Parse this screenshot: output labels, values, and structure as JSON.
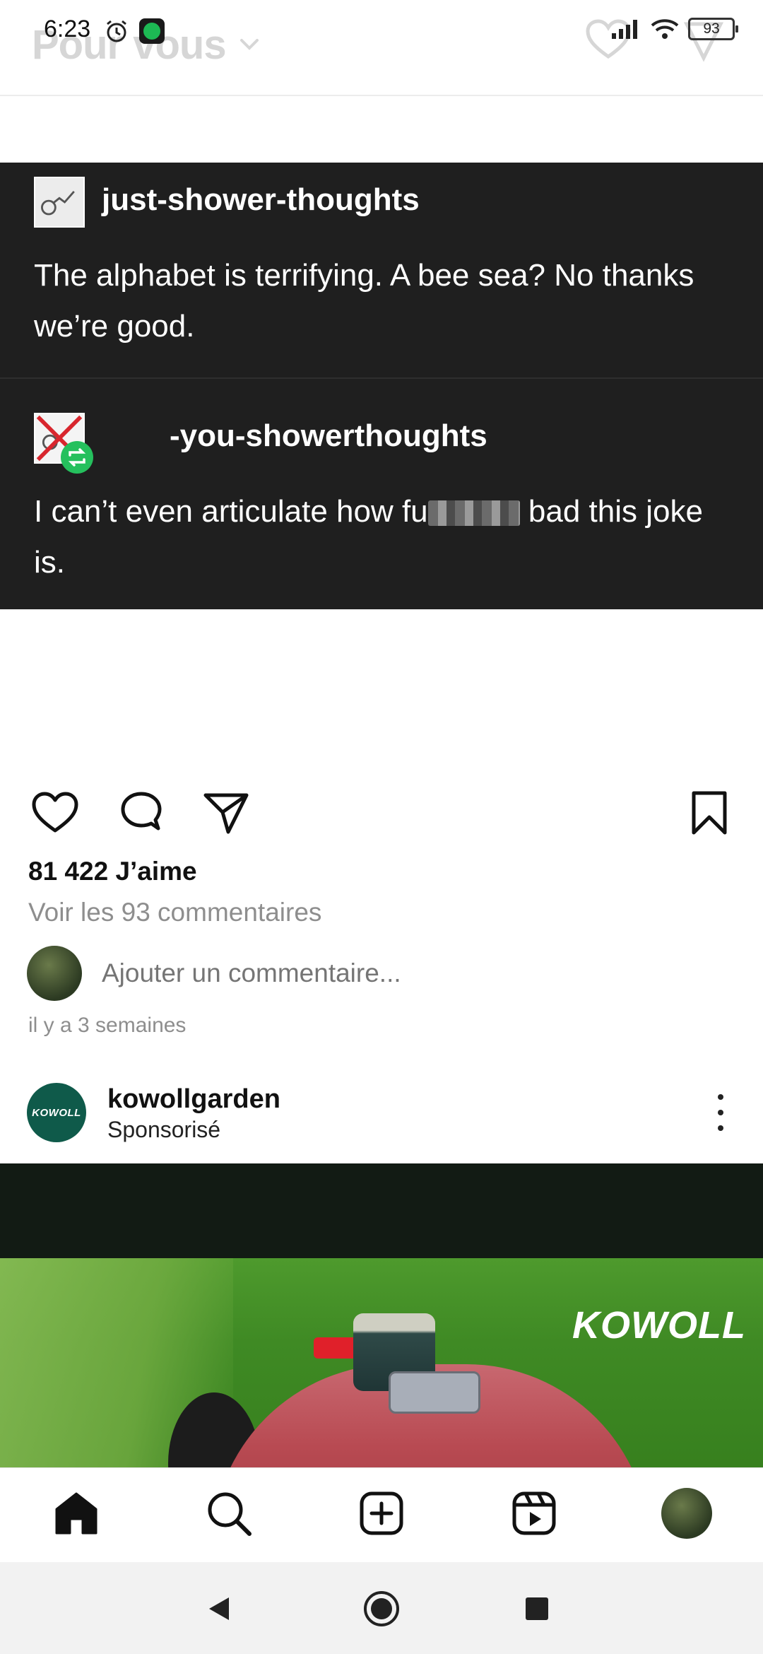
{
  "status_bar": {
    "time": "6:23",
    "battery": "93"
  },
  "header": {
    "title": "Pour vous"
  },
  "post": {
    "image": {
      "block1": {
        "username": "just-shower-thoughts",
        "text": "The alphabet is terrifying. A bee sea? No thanks we’re good."
      },
      "block2": {
        "username": "-you-showerthoughts",
        "text_before_blur": "I can’t even articulate how fu",
        "text_after_blur": " bad this joke is."
      }
    },
    "likes": "81 422 J’aime",
    "view_comments": "Voir les 93 commentaires",
    "comment_placeholder": "Ajouter un commentaire...",
    "timestamp": "il y a 3 semaines"
  },
  "sponsored": {
    "avatar_text": "KOWOLL",
    "username": "kowollgarden",
    "label": "Sponsorisé",
    "image_logo": "KOWOLL"
  },
  "icons": {
    "like": "heart-icon",
    "comment": "comment-icon",
    "share": "send-icon",
    "save": "bookmark-icon",
    "home": "home-icon",
    "search": "search-icon",
    "create": "add-post-icon",
    "reels": "reels-icon"
  },
  "colors": {
    "post_background": "#1f1f1f",
    "reblog_badge": "#25c05d",
    "brand_avatar": "#0f5a4a",
    "muted_text": "#8e8e8e"
  }
}
